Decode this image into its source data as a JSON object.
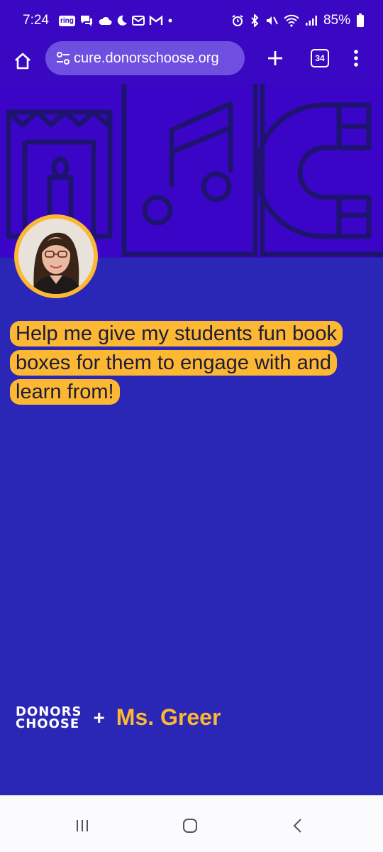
{
  "status_bar": {
    "time": "7:24",
    "ring_label": "ring",
    "battery": "85%"
  },
  "browser": {
    "url": "cure.donorschoose.org",
    "tab_count": "34"
  },
  "project": {
    "headline": "Help me give my students fun book boxes for them to engage with and learn from!",
    "brand_line1": "DONORS",
    "brand_line2": "CHOOSE",
    "plus": "+",
    "teacher": "Ms. Greer"
  },
  "colors": {
    "status_bg": "#3a08c2",
    "hero_bg": "#3b05c8",
    "content_bg": "#2a27b6",
    "accent": "#fcb832"
  }
}
